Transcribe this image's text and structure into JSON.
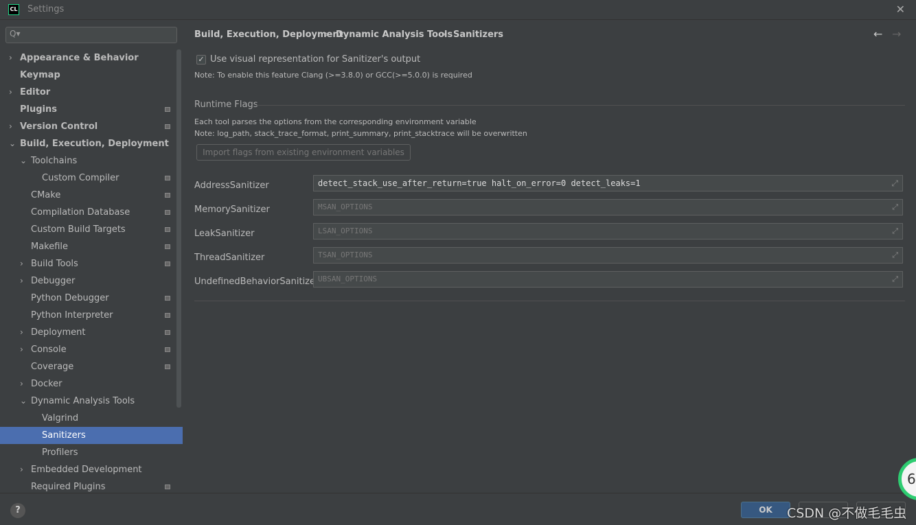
{
  "window": {
    "title": "Settings",
    "logo": "CL"
  },
  "search": {
    "placeholder": "Q▾"
  },
  "sidebar": {
    "items": [
      {
        "label": "Appearance & Behavior",
        "level": 0,
        "arrow": "›",
        "bold": true
      },
      {
        "label": "Keymap",
        "level": 0,
        "bold": true
      },
      {
        "label": "Editor",
        "level": 0,
        "arrow": "›",
        "bold": true
      },
      {
        "label": "Plugins",
        "level": 0,
        "bold": true,
        "mod": true
      },
      {
        "label": "Version Control",
        "level": 0,
        "arrow": "›",
        "bold": true,
        "mod": true
      },
      {
        "label": "Build, Execution, Deployment",
        "level": 0,
        "arrow": "⌄",
        "bold": true
      },
      {
        "label": "Toolchains",
        "level": 1,
        "arrow": "⌄"
      },
      {
        "label": "Custom Compiler",
        "level": 2,
        "mod": true
      },
      {
        "label": "CMake",
        "level": 1,
        "mod": true
      },
      {
        "label": "Compilation Database",
        "level": 1,
        "mod": true
      },
      {
        "label": "Custom Build Targets",
        "level": 1,
        "mod": true
      },
      {
        "label": "Makefile",
        "level": 1,
        "mod": true
      },
      {
        "label": "Build Tools",
        "level": 1,
        "arrow": "›",
        "mod": true
      },
      {
        "label": "Debugger",
        "level": 1,
        "arrow": "›"
      },
      {
        "label": "Python Debugger",
        "level": 1,
        "mod": true
      },
      {
        "label": "Python Interpreter",
        "level": 1,
        "mod": true
      },
      {
        "label": "Deployment",
        "level": 1,
        "arrow": "›",
        "mod": true
      },
      {
        "label": "Console",
        "level": 1,
        "arrow": "›",
        "mod": true
      },
      {
        "label": "Coverage",
        "level": 1,
        "mod": true
      },
      {
        "label": "Docker",
        "level": 1,
        "arrow": "›"
      },
      {
        "label": "Dynamic Analysis Tools",
        "level": 1,
        "arrow": "⌄"
      },
      {
        "label": "Valgrind",
        "level": 2
      },
      {
        "label": "Sanitizers",
        "level": 2,
        "selected": true
      },
      {
        "label": "Profilers",
        "level": 2
      },
      {
        "label": "Embedded Development",
        "level": 1,
        "arrow": "›"
      },
      {
        "label": "Required Plugins",
        "level": 1,
        "mod": true
      }
    ]
  },
  "breadcrumb": [
    "Build, Execution, Deployment",
    "Dynamic Analysis Tools",
    "Sanitizers"
  ],
  "main": {
    "visual_checkbox": "Use visual representation for Sanitizer's output",
    "visual_checked": true,
    "note1": "Note: To enable this feature Clang (>=3.8.0) or GCC(>=5.0.0) is required",
    "runtime_flags": "Runtime Flags",
    "desc1": "Each tool parses the options from the corresponding environment variable",
    "desc2": "Note: log_path, stack_trace_format, print_summary, print_stacktrace will be overwritten",
    "import_button": "Import flags from existing environment variables",
    "sanitizers": [
      {
        "label": "AddressSanitizer",
        "value": "detect_stack_use_after_return=true halt_on_error=0 detect_leaks=1",
        "placeholder": ""
      },
      {
        "label": "MemorySanitizer",
        "value": "",
        "placeholder": "MSAN_OPTIONS"
      },
      {
        "label": "LeakSanitizer",
        "value": "",
        "placeholder": "LSAN_OPTIONS"
      },
      {
        "label": "ThreadSanitizer",
        "value": "",
        "placeholder": "TSAN_OPTIONS"
      },
      {
        "label": "UndefinedBehaviorSanitizer",
        "value": "",
        "placeholder": "UBSAN_OPTIONS"
      }
    ]
  },
  "footer": {
    "ok": "OK",
    "help": "?",
    "watermark": "CSDN @不做毛毛虫",
    "badge": "6"
  },
  "colors": {
    "selection": "#4b6eaf",
    "ok_button": "#365880",
    "badge": "#2ecc71"
  }
}
